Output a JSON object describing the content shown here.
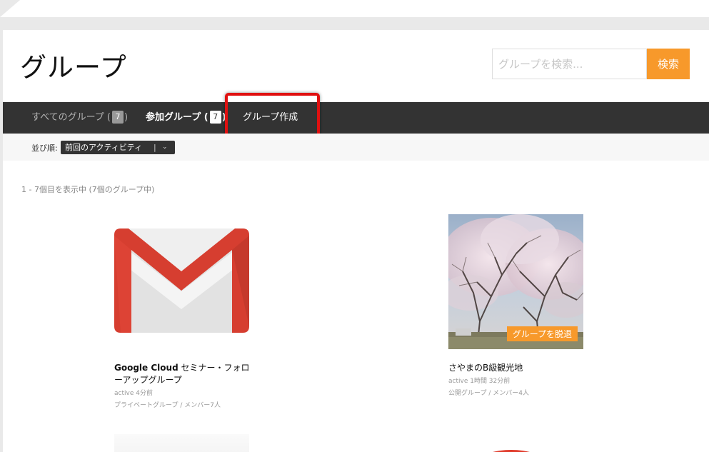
{
  "page": {
    "title": "グループ"
  },
  "search": {
    "placeholder": "グループを検索...",
    "button_label": "検索"
  },
  "nav": {
    "all_groups": {
      "label": "すべてのグループ (",
      "count": "7"
    },
    "my_groups": {
      "label": "参加グループ (",
      "count": "7"
    },
    "create_group": {
      "label": "グループ作成"
    }
  },
  "filter": {
    "sort_label": "並び順:",
    "sort_value": "前回のアクティビティ",
    "sort_separator": "|",
    "sort_chevron": "⌄"
  },
  "listing": {
    "count_text": "1 - 7個目を表示中 (7個のグループ中)"
  },
  "groups": [
    {
      "name_bold": "Google Cloud",
      "name_rest": " セミナー・フォローアップグループ",
      "activity": "active 4分前",
      "type": "プライベートグループ / メンバー7人",
      "avatar_icon": "gmail-logo-icon"
    },
    {
      "name_bold": "",
      "name_rest": "さやまのB級観光地",
      "activity": "active 1時間 32分前",
      "type": "公開グループ / メンバー4人",
      "avatar_icon": "cherry-blossom-photo",
      "leave_label": "グループを脱退"
    }
  ],
  "colors": {
    "accent": "#f7992b",
    "nav_bg": "#333333",
    "highlight": "#e01010"
  }
}
